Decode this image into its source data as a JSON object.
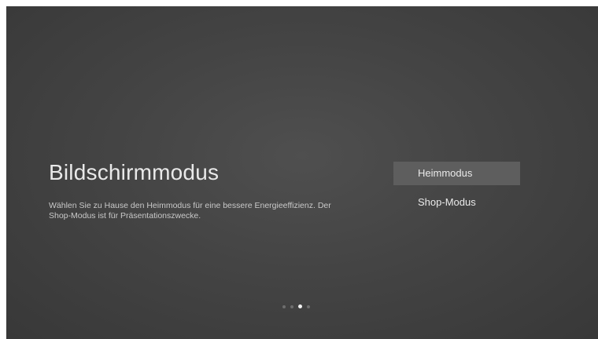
{
  "screen": {
    "title": "Bildschirmmodus",
    "description": "Wählen Sie zu Hause den Heimmodus für eine bessere Energieeffizienz. Der Shop-Modus ist für Präsentationszwecke."
  },
  "options": [
    {
      "label": "Heimmodus",
      "selected": true
    },
    {
      "label": "Shop-Modus",
      "selected": false
    }
  ],
  "pagination": {
    "total_steps": 4,
    "current_step": 3
  },
  "colors": {
    "background": "#444444",
    "selected_option_bg": "#5e5e5e",
    "active_dot": "#f2f2f2",
    "inactive_dot": "#6e6e6e"
  }
}
